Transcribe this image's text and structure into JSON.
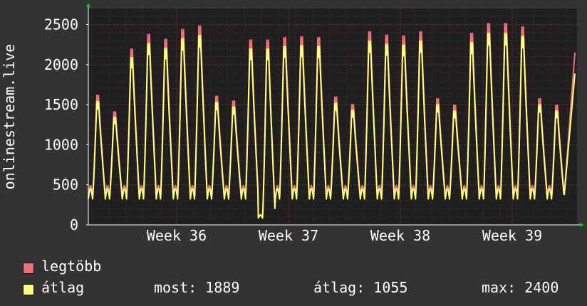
{
  "chart_data": {
    "type": "line",
    "ylabel": "onlinestream.live",
    "ylim": [
      0,
      2700
    ],
    "y_ticks": [
      0,
      500,
      1000,
      1500,
      2000,
      2500
    ],
    "x_ticks": [
      "Week 36",
      "Week 37",
      "Week 38",
      "Week 39"
    ],
    "grid": true,
    "colors": {
      "background": "#333333",
      "plot": "#1f1f1f",
      "grid_major": "#6a3030",
      "grid_minor": "#4a2a2a",
      "arrow": "#00cc00"
    },
    "daily_peaks": [
      1570,
      1370,
      2130,
      2310,
      2250,
      2370,
      2410,
      1560,
      1500,
      2240,
      2240,
      2270,
      2280,
      2270,
      1550,
      1460,
      2340,
      2300,
      2290,
      2340,
      1530,
      1450,
      2320,
      2440,
      2440,
      2400,
      1530,
      1450
    ],
    "series": [
      {
        "name": "legtöbb",
        "color": "#f0707a",
        "peak_factor": 1.03,
        "min_factor": 1.03
      },
      {
        "name": "átlag",
        "color": "#ffff80",
        "peak_factor": 0.98,
        "min_factor": 0.95
      }
    ]
  },
  "legend": {
    "max_label": "legtöbb",
    "avg_label": "átlag"
  },
  "stats": {
    "current": "most: 1889",
    "average": "átlag: 1055",
    "maximum": "max: 2400"
  }
}
